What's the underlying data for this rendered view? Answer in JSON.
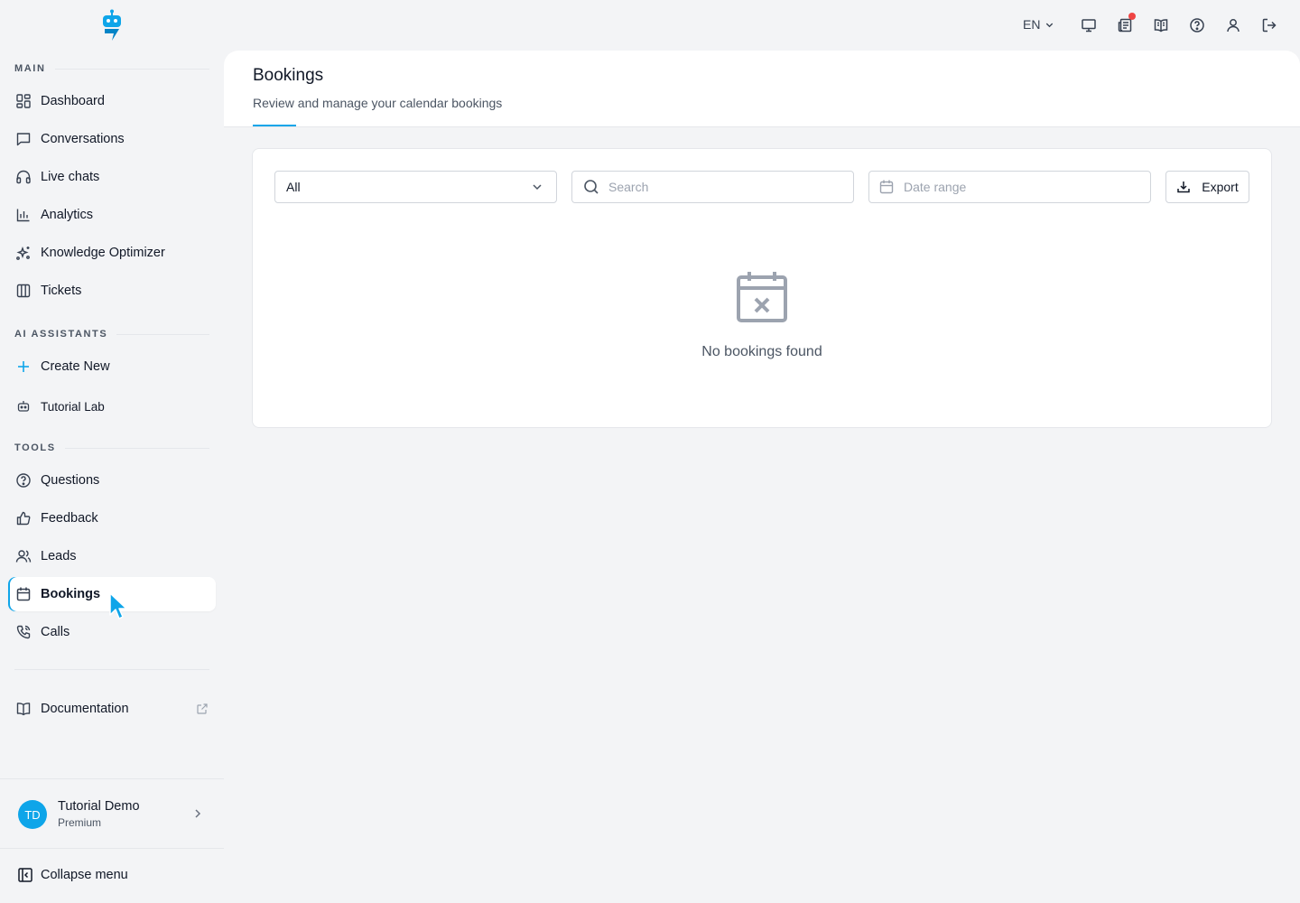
{
  "sidebar": {
    "sections": {
      "main": "MAIN",
      "ai_assistants": "AI ASSISTANTS",
      "tools": "TOOLS"
    },
    "main_items": [
      {
        "label": "Dashboard",
        "icon": "dashboard-icon"
      },
      {
        "label": "Conversations",
        "icon": "chat-bubble-icon"
      },
      {
        "label": "Live chats",
        "icon": "headphones-icon"
      },
      {
        "label": "Analytics",
        "icon": "bar-chart-icon"
      },
      {
        "label": "Knowledge Optimizer",
        "icon": "sparkles-icon"
      },
      {
        "label": "Tickets",
        "icon": "columns-icon"
      }
    ],
    "ai_items": [
      {
        "label": "Create New",
        "icon": "plus-icon"
      },
      {
        "label": "Tutorial Lab",
        "icon": "robot-icon"
      }
    ],
    "tool_items": [
      {
        "label": "Questions",
        "icon": "question-circle-icon"
      },
      {
        "label": "Feedback",
        "icon": "thumbs-up-icon"
      },
      {
        "label": "Leads",
        "icon": "users-icon"
      },
      {
        "label": "Bookings",
        "icon": "calendar-icon",
        "active": true
      },
      {
        "label": "Calls",
        "icon": "phone-icon"
      }
    ],
    "documentation": {
      "label": "Documentation",
      "icon": "book-open-icon"
    },
    "user": {
      "initials": "TD",
      "name": "Tutorial Demo",
      "plan": "Premium"
    },
    "collapse_label": "Collapse menu"
  },
  "topbar": {
    "language": "EN",
    "icons": [
      "monitor-icon",
      "news-icon",
      "book-icon",
      "help-icon",
      "user-icon",
      "logout-icon"
    ]
  },
  "page": {
    "title": "Bookings",
    "subtitle": "Review and manage your calendar bookings"
  },
  "filters": {
    "status_value": "All",
    "search_placeholder": "Search",
    "date_placeholder": "Date range",
    "export_label": "Export"
  },
  "empty_state": {
    "text": "No bookings found"
  },
  "colors": {
    "accent": "#0ea5e9",
    "notification": "#ef4444"
  }
}
